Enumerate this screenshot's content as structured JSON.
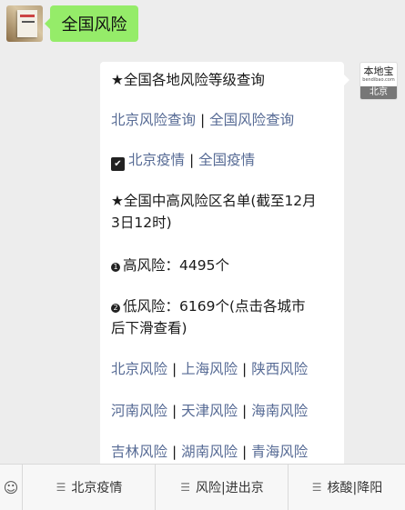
{
  "chat": {
    "user_message": "全国风险",
    "bot": {
      "avatar_title": "本地宝",
      "avatar_subtitle": "bendibao.com",
      "avatar_city": "北京"
    },
    "reply": {
      "line1": "★全国各地风险等级查询",
      "line2_a": "北京风险查询",
      "line2_sep": " | ",
      "line2_b": "全国风险查询",
      "line3_icon": "✔",
      "line3_a": "北京疫情",
      "line3_sep": " | ",
      "line3_b": "全国疫情",
      "line4": "★全国中高风险区名单(截至12月",
      "line5": "3日12时)",
      "line6_dot": "1",
      "line6": "高风险：4495个",
      "line7_dot": "2",
      "line7": "低风险：6169个(点击各城市",
      "line8": "后下滑查看)",
      "line9_a": "北京风险",
      "line9_b": "上海风险",
      "line9_c": "陕西风险",
      "line10_a": "河南风险",
      "line10_b": "天津风险",
      "line10_c": "海南风险",
      "line11_a": "吉林风险",
      "line11_b": "湖南风险",
      "line11_c": "青海风险",
      "sep": " | "
    }
  },
  "bottom_menu": {
    "item1": "核酸|降阳",
    "item2": "风险|进出京",
    "item3": "北京疫情"
  }
}
